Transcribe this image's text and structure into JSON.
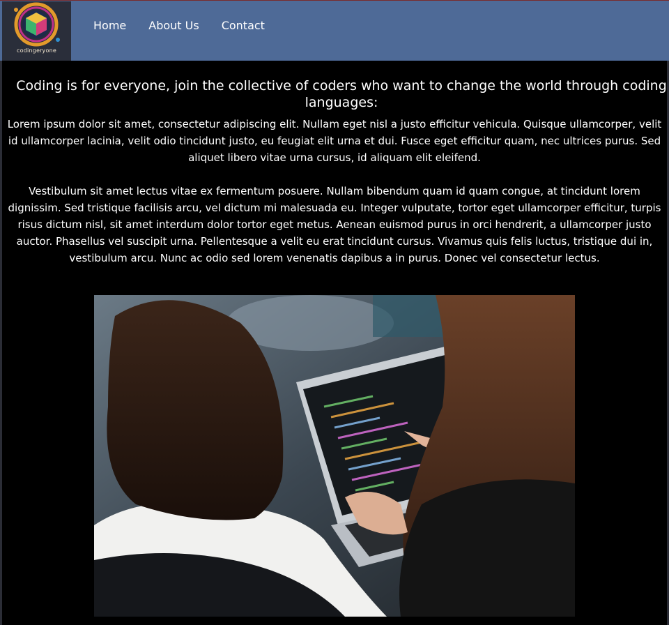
{
  "logo": {
    "caption": "codingeryone"
  },
  "nav": {
    "items": [
      {
        "label": "Home"
      },
      {
        "label": "About Us"
      },
      {
        "label": "Contact"
      }
    ]
  },
  "main": {
    "headline": "Coding is for everyone, join the collective of coders who want to change the world through coding languages:",
    "paragraphs": [
      "Lorem ipsum dolor sit amet, consectetur adipiscing elit. Nullam eget nisl a justo efficitur vehicula. Quisque ullamcorper, velit id ullamcorper lacinia, velit odio tincidunt justo, eu feugiat elit urna et dui. Fusce eget efficitur quam, nec ultrices purus. Sed aliquet libero vitae urna cursus, id aliquam elit eleifend.",
      "Vestibulum sit amet lectus vitae ex fermentum posuere. Nullam bibendum quam id quam congue, at tincidunt lorem dignissim. Sed tristique facilisis arcu, vel dictum mi malesuada eu. Integer vulputate, tortor eget ullamcorper efficitur, turpis risus dictum nisl, sit amet interdum dolor tortor eget metus. Aenean euismod purus in orci hendrerit, a ullamcorper justo auctor. Phasellus vel suscipit urna. Pellentesque a velit eu erat tincidunt cursus. Vivamus quis felis luctus, tristique dui in, vestibulum arcu. Nunc ac odio sed lorem venenatis dapibus a in purus. Donec vel consectetur lectus."
    ]
  },
  "colors": {
    "navbar": "#4e6a97",
    "background": "#000000",
    "text": "#ffffff"
  }
}
